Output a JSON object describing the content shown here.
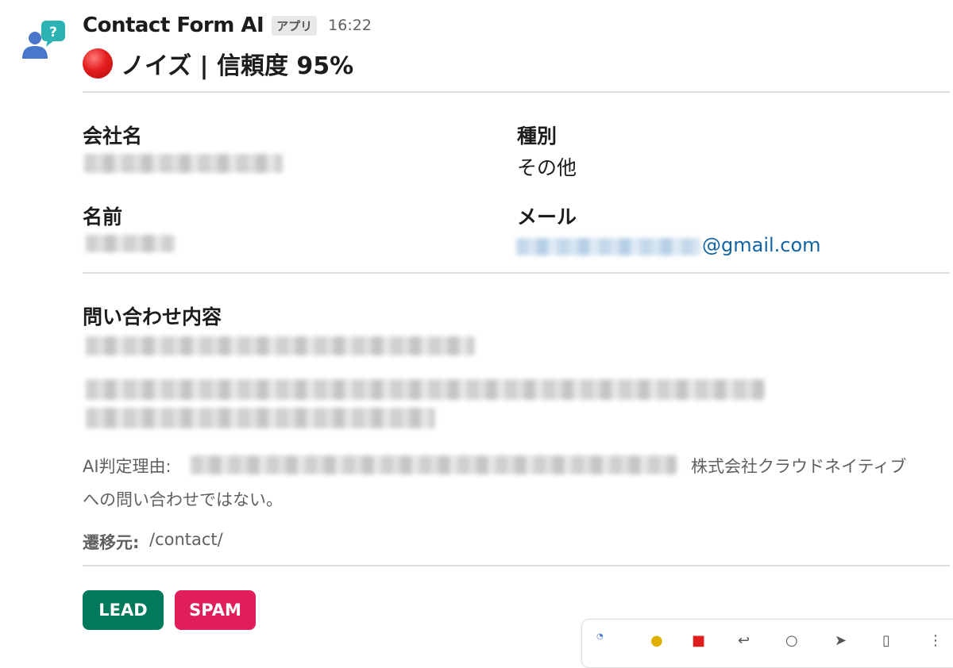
{
  "message": {
    "app_name": "Contact Form AI",
    "app_badge": "アプリ",
    "time": "16:22",
    "title": "ノイズ | 信頼度 95%"
  },
  "fields": {
    "company_label": "会社名",
    "type_label": "種別",
    "type_value": "その他",
    "name_label": "名前",
    "email_label": "メール",
    "email_domain": "@gmail.com"
  },
  "inquiry": {
    "label": "問い合わせ内容"
  },
  "ai_reason": {
    "label": "AI判定理由:",
    "text_line1": "株式会社クラウドネイティブ",
    "text_line2": "への問い合わせではない。"
  },
  "source": {
    "label": "遷移元:",
    "value": "/contact/"
  },
  "actions": {
    "lead_label": "LEAD",
    "spam_label": "SPAM"
  },
  "colors": {
    "lead": "#007a5a",
    "spam": "#e01e5a",
    "link": "#1264a3",
    "status": "#e41e1e"
  },
  "icons": {
    "avatar": "person-question-avatar-icon",
    "status": "red-circle-icon"
  }
}
